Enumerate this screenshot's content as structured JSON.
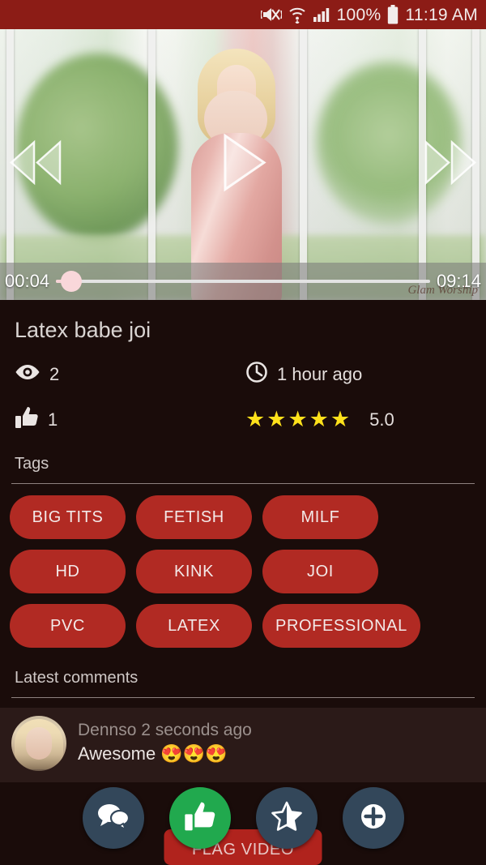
{
  "status_bar": {
    "background": "#8c1c16",
    "battery_percent": "100%",
    "time": "11:19 AM",
    "icons": [
      "mute-vibrate-icon",
      "wifi-icon",
      "signal-icon",
      "battery-icon"
    ]
  },
  "player": {
    "current_time": "00:04",
    "duration": "09:14",
    "progress_percent": 4,
    "watermark": "Glam Worship",
    "controls": [
      "rewind-button",
      "play-button",
      "fast-forward-button"
    ]
  },
  "video": {
    "title": "Latex babe joi",
    "views": "2",
    "uploaded": "1 hour ago",
    "likes": "1",
    "rating": "5.0",
    "stars": 5,
    "star_color": "#ffe11b"
  },
  "sections": {
    "tags_label": "Tags",
    "comments_label": "Latest comments"
  },
  "tags": [
    {
      "label": "BIG TITS"
    },
    {
      "label": "FETISH"
    },
    {
      "label": "MILF"
    },
    {
      "label": "HD"
    },
    {
      "label": "KINK"
    },
    {
      "label": "JOI"
    },
    {
      "label": "PVC"
    },
    {
      "label": "LATEX"
    },
    {
      "label": "PROFESSIONAL"
    }
  ],
  "tag_color": "#b12a23",
  "comments": [
    {
      "author": "Dennso",
      "time": "2 seconds ago",
      "header": "Dennso 2 seconds ago",
      "text": "Awesome 😍😍😍"
    }
  ],
  "bottom": {
    "flag_label": "FLAG VIDEO",
    "flag_color": "#b0231d",
    "fabs": [
      {
        "name": "comments-fab",
        "icon": "chat-bubbles-icon",
        "color": "#33475a"
      },
      {
        "name": "like-fab",
        "icon": "thumbs-up-icon",
        "color": "#21a94e"
      },
      {
        "name": "favorite-fab",
        "icon": "half-star-icon",
        "color": "#33475a"
      },
      {
        "name": "add-fab",
        "icon": "plus-circle-icon",
        "color": "#33475a"
      }
    ]
  }
}
